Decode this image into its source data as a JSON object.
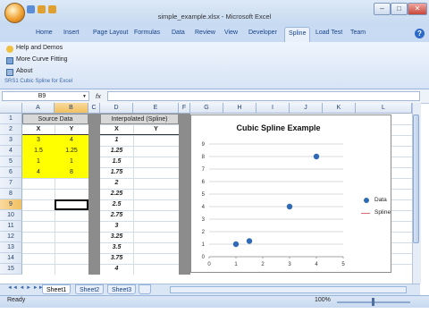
{
  "window": {
    "title": "simple_example.xlsx - Microsoft Excel",
    "controls": {
      "minimize": "–",
      "restore": "□",
      "close": "✕"
    }
  },
  "ribbon": {
    "tabs": [
      "Home",
      "Insert",
      "Page Layout",
      "Formulas",
      "Data",
      "Review",
      "View",
      "Developer",
      "Spline",
      "Load Test",
      "Team"
    ],
    "active_tab": "Spline",
    "commands": [
      "Help and Demos",
      "More Curve Fitting",
      "About"
    ],
    "group_label": "SRS1 Cubic Spline for Excel",
    "help_icon": "?"
  },
  "formula_bar": {
    "name_box": "B9",
    "fx": "fx",
    "value": ""
  },
  "columns": [
    "A",
    "B",
    "C",
    "D",
    "E",
    "F",
    "G",
    "H",
    "I",
    "J",
    "K",
    "L"
  ],
  "selected_column": "B",
  "rows": [
    "1",
    "2",
    "3",
    "4",
    "5",
    "6",
    "7",
    "8",
    "9",
    "10",
    "11",
    "12",
    "13",
    "14",
    "15"
  ],
  "selected_row": "9",
  "sheet": {
    "source_header": "Source Data",
    "source_cols": [
      "X",
      "Y"
    ],
    "source_rows": [
      [
        "3",
        "4"
      ],
      [
        "1.5",
        "1.25"
      ],
      [
        "1",
        "1"
      ],
      [
        "4",
        "8"
      ]
    ],
    "interp_header": "Interpolated (Spline)",
    "interp_cols": [
      "X",
      "Y"
    ],
    "interp_x": [
      "1",
      "1.25",
      "1.5",
      "1.75",
      "2",
      "2.25",
      "2.5",
      "2.75",
      "3",
      "3.25",
      "3.5",
      "3.75",
      "4"
    ]
  },
  "chart_data": {
    "type": "scatter",
    "title": "Cubic Spline Example",
    "xlim": [
      0,
      5
    ],
    "ylim": [
      0,
      9
    ],
    "x_ticks": [
      "0",
      "1",
      "2",
      "3",
      "4",
      "5"
    ],
    "y_ticks": [
      "0",
      "1",
      "2",
      "3",
      "4",
      "5",
      "6",
      "7",
      "8",
      "9"
    ],
    "grid": true,
    "legend_position": "right",
    "series": [
      {
        "name": "Data",
        "x": [
          1,
          1.5,
          3,
          4
        ],
        "y": [
          1,
          1.25,
          4,
          8
        ]
      },
      {
        "name": "Spline",
        "x": [],
        "y": []
      }
    ],
    "colors": {
      "data": "#2f6bb5",
      "spline": "#d87070"
    }
  },
  "sheet_tabs": [
    "Sheet1",
    "Sheet2",
    "Sheet3"
  ],
  "active_sheet": "Sheet1",
  "status": {
    "text": "Ready",
    "zoom": "100%"
  },
  "colors": {
    "highlight": "#ffff00",
    "dark_column": "#8c8c8c",
    "accent": "#15428b"
  }
}
